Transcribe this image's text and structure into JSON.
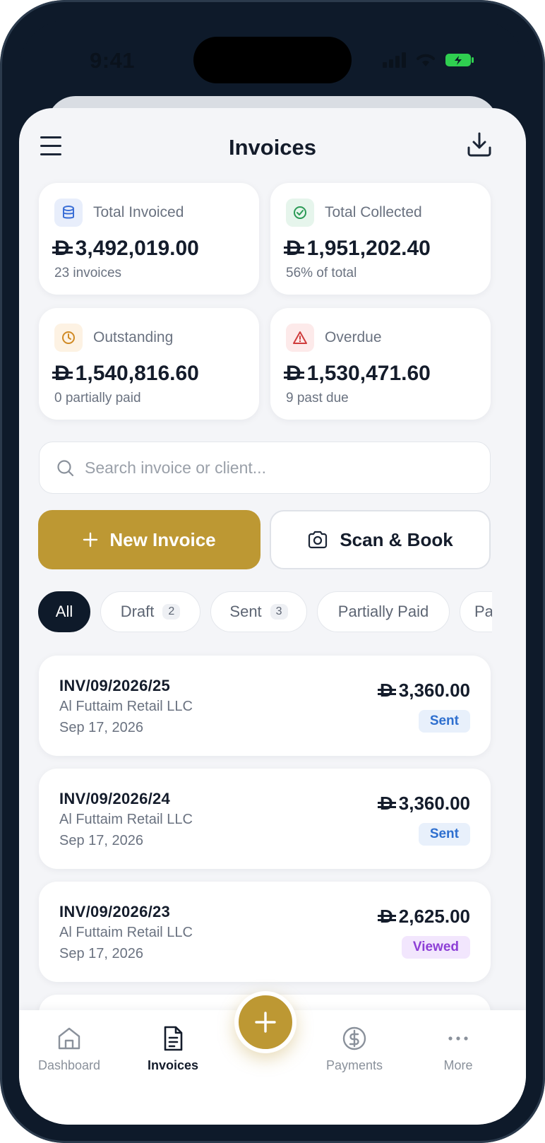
{
  "status_bar": {
    "time": "9:41"
  },
  "header": {
    "title": "Invoices"
  },
  "stats": [
    {
      "label": "Total Invoiced",
      "value": "3,492,019.00",
      "sub": "23 invoices",
      "icon": "database-icon",
      "icon_color": "#3b6fd6",
      "icon_bg": "#e8eefb"
    },
    {
      "label": "Total Collected",
      "value": "1,951,202.40",
      "sub": "56% of total",
      "icon": "check-circle-icon",
      "icon_color": "#2b9a56",
      "icon_bg": "#e6f5ec"
    },
    {
      "label": "Outstanding",
      "value": "1,540,816.60",
      "sub": "0 partially paid",
      "icon": "clock-icon",
      "icon_color": "#d08a24",
      "icon_bg": "#fdf2e3"
    },
    {
      "label": "Overdue",
      "value": "1,530,471.60",
      "sub": "9 past due",
      "icon": "warning-icon",
      "icon_color": "#cf3c3c",
      "icon_bg": "#fdeaea"
    }
  ],
  "currency_symbol": "D",
  "search": {
    "placeholder": "Search invoice or client...",
    "value": ""
  },
  "actions": {
    "new_invoice": "New Invoice",
    "scan_book": "Scan & Book"
  },
  "filters": [
    {
      "label": "All",
      "count": null,
      "active": true
    },
    {
      "label": "Draft",
      "count": "2"
    },
    {
      "label": "Sent",
      "count": "3"
    },
    {
      "label": "Partially Paid",
      "count": null
    },
    {
      "label": "Pa",
      "count": null
    }
  ],
  "invoices": [
    {
      "number": "INV/09/2026/25",
      "client": "Al Futtaim Retail LLC",
      "date": "Sep 17, 2026",
      "amount": "3,360.00",
      "status": "Sent"
    },
    {
      "number": "INV/09/2026/24",
      "client": "Al Futtaim Retail LLC",
      "date": "Sep 17, 2026",
      "amount": "3,360.00",
      "status": "Sent"
    },
    {
      "number": "INV/09/2026/23",
      "client": "Al Futtaim Retail LLC",
      "date": "Sep 17, 2026",
      "amount": "2,625.00",
      "status": "Viewed"
    }
  ],
  "tabbar": {
    "dashboard": "Dashboard",
    "invoices": "Invoices",
    "payments": "Payments",
    "more": "More",
    "active": "invoices"
  },
  "colors": {
    "accent": "#bd9833",
    "navy": "#0e1a2a",
    "background": "#f4f5f8"
  }
}
